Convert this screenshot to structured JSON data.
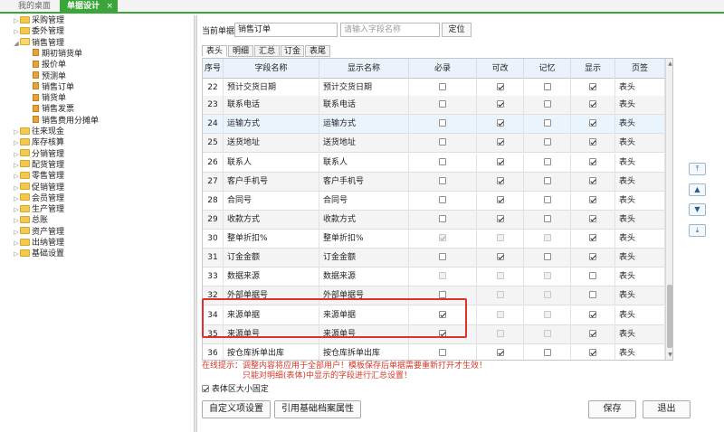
{
  "tabs": {
    "desktop": "我的桌面",
    "current": "单据设计",
    "close": "×"
  },
  "tree": [
    {
      "label": "采购管理",
      "type": "folder",
      "expanded": false,
      "indent": 0
    },
    {
      "label": "委外管理",
      "type": "folder",
      "expanded": false,
      "indent": 0
    },
    {
      "label": "销售管理",
      "type": "folder",
      "expanded": true,
      "indent": 0
    },
    {
      "label": "期初销货单",
      "type": "doc",
      "indent": 1
    },
    {
      "label": "报价单",
      "type": "doc",
      "indent": 1
    },
    {
      "label": "预测单",
      "type": "doc",
      "indent": 1
    },
    {
      "label": "销售订单",
      "type": "doc",
      "indent": 1
    },
    {
      "label": "销货单",
      "type": "doc",
      "indent": 1
    },
    {
      "label": "销售发票",
      "type": "doc",
      "indent": 1
    },
    {
      "label": "销售费用分摊单",
      "type": "doc",
      "indent": 1
    },
    {
      "label": "往来现金",
      "type": "folder",
      "expanded": false,
      "indent": 0
    },
    {
      "label": "库存核算",
      "type": "folder",
      "expanded": false,
      "indent": 0
    },
    {
      "label": "分销管理",
      "type": "folder",
      "expanded": false,
      "indent": 0
    },
    {
      "label": "配货管理",
      "type": "folder",
      "expanded": false,
      "indent": 0
    },
    {
      "label": "零售管理",
      "type": "folder",
      "expanded": false,
      "indent": 0
    },
    {
      "label": "促销管理",
      "type": "folder",
      "expanded": false,
      "indent": 0
    },
    {
      "label": "会员管理",
      "type": "folder",
      "expanded": false,
      "indent": 0
    },
    {
      "label": "生产管理",
      "type": "folder",
      "expanded": false,
      "indent": 0
    },
    {
      "label": "总账",
      "type": "folder",
      "expanded": false,
      "indent": 0
    },
    {
      "label": "资产管理",
      "type": "folder",
      "expanded": false,
      "indent": 0
    },
    {
      "label": "出纳管理",
      "type": "folder",
      "expanded": false,
      "indent": 0
    },
    {
      "label": "基础设置",
      "type": "folder",
      "expanded": false,
      "indent": 0
    }
  ],
  "toolbar": {
    "current_label": "当前单据",
    "current_value": "销售订单",
    "search_placeholder": "请输入字段名称",
    "locate_button": "定位"
  },
  "subtabs": [
    "表头",
    "明细",
    "汇总",
    "订金",
    "表尾"
  ],
  "columns": [
    "序号",
    "字段名称",
    "显示名称",
    "必录",
    "可改",
    "记忆",
    "显示",
    "页签"
  ],
  "rows": [
    {
      "no": "22",
      "field": "预计交货日期",
      "display": "预计交货日期",
      "req": [
        false,
        false
      ],
      "edit": [
        true,
        false
      ],
      "mem": [
        false,
        false
      ],
      "show": [
        true,
        false
      ],
      "page": "表头"
    },
    {
      "no": "23",
      "field": "联系电话",
      "display": "联系电话",
      "req": [
        false,
        false
      ],
      "edit": [
        true,
        false
      ],
      "mem": [
        false,
        false
      ],
      "show": [
        true,
        false
      ],
      "page": "表头"
    },
    {
      "no": "24",
      "field": "运输方式",
      "display": "运输方式",
      "req": [
        false,
        false
      ],
      "edit": [
        true,
        false
      ],
      "mem": [
        false,
        false
      ],
      "show": [
        true,
        false
      ],
      "page": "表头"
    },
    {
      "no": "25",
      "field": "送货地址",
      "display": "送货地址",
      "req": [
        false,
        false
      ],
      "edit": [
        true,
        false
      ],
      "mem": [
        false,
        false
      ],
      "show": [
        true,
        false
      ],
      "page": "表头"
    },
    {
      "no": "26",
      "field": "联系人",
      "display": "联系人",
      "req": [
        false,
        false
      ],
      "edit": [
        true,
        false
      ],
      "mem": [
        false,
        false
      ],
      "show": [
        true,
        false
      ],
      "page": "表头"
    },
    {
      "no": "27",
      "field": "客户手机号",
      "display": "客户手机号",
      "req": [
        false,
        false
      ],
      "edit": [
        true,
        false
      ],
      "mem": [
        false,
        false
      ],
      "show": [
        true,
        false
      ],
      "page": "表头"
    },
    {
      "no": "28",
      "field": "合同号",
      "display": "合同号",
      "req": [
        false,
        false
      ],
      "edit": [
        true,
        false
      ],
      "mem": [
        false,
        false
      ],
      "show": [
        true,
        false
      ],
      "page": "表头"
    },
    {
      "no": "29",
      "field": "收款方式",
      "display": "收款方式",
      "req": [
        false,
        false
      ],
      "edit": [
        true,
        false
      ],
      "mem": [
        false,
        false
      ],
      "show": [
        true,
        false
      ],
      "page": "表头"
    },
    {
      "no": "30",
      "field": "整单折扣%",
      "display": "整单折扣%",
      "req": [
        true,
        true
      ],
      "edit": [
        false,
        true
      ],
      "mem": [
        false,
        true
      ],
      "show": [
        true,
        false
      ],
      "page": "表头"
    },
    {
      "no": "31",
      "field": "订金金额",
      "display": "订金金额",
      "req": [
        false,
        false
      ],
      "edit": [
        true,
        false
      ],
      "mem": [
        false,
        false
      ],
      "show": [
        true,
        false
      ],
      "page": "表头"
    },
    {
      "no": "33",
      "field": "数据来源",
      "display": "数据来源",
      "req": [
        false,
        true
      ],
      "edit": [
        false,
        true
      ],
      "mem": [
        false,
        true
      ],
      "show": [
        false,
        false
      ],
      "page": "表头"
    },
    {
      "no": "32",
      "field": "外部单据号",
      "display": "外部单据号",
      "req": [
        false,
        false
      ],
      "edit": [
        false,
        true
      ],
      "mem": [
        false,
        true
      ],
      "show": [
        false,
        false
      ],
      "page": "表头"
    },
    {
      "no": "34",
      "field": "来源单据",
      "display": "来源单据",
      "req": [
        true,
        false
      ],
      "edit": [
        false,
        true
      ],
      "mem": [
        false,
        true
      ],
      "show": [
        true,
        false
      ],
      "page": "表头"
    },
    {
      "no": "35",
      "field": "来源单号",
      "display": "来源单号",
      "req": [
        true,
        false
      ],
      "edit": [
        false,
        true
      ],
      "mem": [
        false,
        true
      ],
      "show": [
        true,
        false
      ],
      "page": "表头"
    },
    {
      "no": "36",
      "field": "按仓库拆单出库",
      "display": "按仓库拆单出库",
      "req": [
        false,
        false
      ],
      "edit": [
        true,
        false
      ],
      "mem": [
        false,
        false
      ],
      "show": [
        true,
        false
      ],
      "page": "表头"
    }
  ],
  "move_buttons": {
    "top": "⤒",
    "up": "▲",
    "down": "▼",
    "bottom": "⤓"
  },
  "hint": {
    "line1": "在线提示：调整内容将应用于全部用户！模板保存后单据需要重新打开才生效！",
    "line2": "只能对明细(表体)中显示的字段进行汇总设置！"
  },
  "fixed_size": {
    "checked": true,
    "label": "表体区大小固定"
  },
  "buttons": {
    "custom_settings": "自定义项设置",
    "reference_attr": "引用基础档案属性",
    "save": "保存",
    "exit": "退出"
  }
}
